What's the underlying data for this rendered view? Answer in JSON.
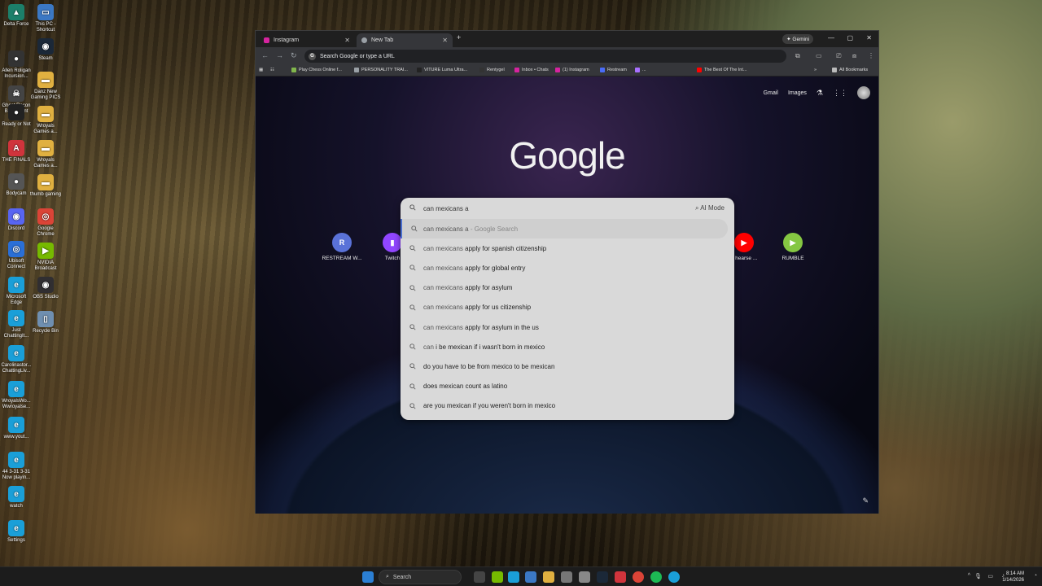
{
  "desktop_icons_left": [
    {
      "label": "Delta Force",
      "color": "#1c7f6a",
      "glyph": "▲"
    },
    {
      "label": "Allen Roligan Incursion...",
      "color": "#333333",
      "glyph": "●"
    },
    {
      "label": "Ghost Recon Breakpoint",
      "color": "#444444",
      "glyph": "☠"
    },
    {
      "label": "Ready or Not",
      "color": "#222222",
      "glyph": "●"
    },
    {
      "label": "THE FINALS",
      "color": "#d0343c",
      "glyph": "A"
    },
    {
      "label": "Bodycam",
      "color": "#555555",
      "glyph": "●"
    },
    {
      "label": "Discord",
      "color": "#5865f2",
      "glyph": "◉"
    },
    {
      "label": "Ubisoft Connect",
      "color": "#2a6fd6",
      "glyph": "◎"
    },
    {
      "label": "Microsoft Edge",
      "color": "#1a9fd8",
      "glyph": "e"
    },
    {
      "label": "Just ChattingIt...",
      "color": "#1a9fd8",
      "glyph": "e"
    },
    {
      "label": "Carolinastor... ChattingLiv...",
      "color": "#1a9fd8",
      "glyph": "e"
    },
    {
      "label": "WroyalsWo... Wwroyalse...",
      "color": "#1a9fd8",
      "glyph": "e"
    },
    {
      "label": "www.yout...",
      "color": "#1a9fd8",
      "glyph": "e"
    },
    {
      "label": "44 3-31 3-31 Now playin...",
      "color": "#1a9fd8",
      "glyph": "e"
    },
    {
      "label": "watch",
      "color": "#1a9fd8",
      "glyph": "e"
    },
    {
      "label": "Settings",
      "color": "#1a9fd8",
      "glyph": "e"
    }
  ],
  "desktop_icons_right_col": [
    {
      "label": "This PC - Shortcut",
      "color": "#3b78c4",
      "glyph": "▭"
    },
    {
      "label": "Steam",
      "color": "#1b2838",
      "glyph": "◉"
    },
    {
      "label": "Danz New Gaming PICS",
      "color": "#e0b040",
      "glyph": "▬"
    },
    {
      "label": "Wroyals Games a...",
      "color": "#e0b040",
      "glyph": "▬"
    },
    {
      "label": "Wroyals Games a...",
      "color": "#e0b040",
      "glyph": "▬"
    },
    {
      "label": "thumb gaming",
      "color": "#e0b040",
      "glyph": "▬"
    },
    {
      "label": "Google Chrome",
      "color": "#db4437",
      "glyph": "◎"
    },
    {
      "label": "NVIDIA Broadcast",
      "color": "#76b900",
      "glyph": "▶"
    },
    {
      "label": "OBS Studio",
      "color": "#302e31",
      "glyph": "◉"
    },
    {
      "label": "Recycle Bin",
      "color": "#6f8fb0",
      "glyph": "▯"
    }
  ],
  "browser": {
    "tabs": [
      {
        "label": "Instagram",
        "fav_color": "#d6249f"
      },
      {
        "label": "New Tab",
        "fav_color": "#9aa0a6"
      }
    ],
    "new_tab_symbol": "+",
    "gemini_label": "✦ Gemini",
    "omnibox_placeholder": "Search Google or type a URL",
    "bookmarks": [
      {
        "label": "Play Chess Online f...",
        "color": "#81b64c"
      },
      {
        "label": "PERSONALITY TRAI...",
        "color": "#9aa0a6"
      },
      {
        "label": "VITURE Luma Ultra...",
        "color": "#222222"
      },
      {
        "label": "Rentygel",
        "color": "#333333"
      },
      {
        "label": "Inbox • Chats",
        "color": "#d6249f"
      },
      {
        "label": "(1) Instagram",
        "color": "#d6249f"
      },
      {
        "label": "Restream",
        "color": "#4a6cf7"
      },
      {
        "label": "...",
        "color": "#a970ff"
      },
      {
        "label": "The Best Of The Int...",
        "color": "#ff0000"
      }
    ],
    "all_bookmarks": "All Bookmarks"
  },
  "ntp": {
    "gmail": "Gmail",
    "images": "Images",
    "logo": "Google",
    "shortcuts": [
      {
        "label": "RESTREAM W...",
        "glyph": "R",
        "color": "#5a72d8"
      },
      {
        "label": "Twitch",
        "glyph": "▮",
        "color": "#9146ff"
      },
      {
        "label": "n hearse ...",
        "glyph": "▶",
        "color": "#ff0000"
      },
      {
        "label": "RUMBLE",
        "glyph": "▶",
        "color": "#85c742"
      }
    ]
  },
  "search": {
    "query": "can mexicans a",
    "ai_mode": "AI Mode",
    "suggestions": [
      {
        "pre": "can mexicans a",
        "rest": "",
        "tail": " - Google Search"
      },
      {
        "pre": "can mexicans",
        "rest": " apply for spanish citizenship",
        "tail": ""
      },
      {
        "pre": "can mexicans",
        "rest": " apply for global entry",
        "tail": ""
      },
      {
        "pre": "can mexicans",
        "rest": " apply for asylum",
        "tail": ""
      },
      {
        "pre": "can mexicans",
        "rest": " apply for us citizenship",
        "tail": ""
      },
      {
        "pre": "can mexicans",
        "rest": " apply for asylum in the us",
        "tail": ""
      },
      {
        "pre": "can",
        "rest": " i be mexican if i wasn't born in mexico",
        "tail": ""
      },
      {
        "pre": "",
        "rest": "do you have to be from mexico to be mexican",
        "tail": ""
      },
      {
        "pre": "",
        "rest": "does mexican count as latino",
        "tail": ""
      },
      {
        "pre": "",
        "rest": "are you mexican if you weren't born in mexico",
        "tail": ""
      }
    ]
  },
  "taskbar": {
    "search_placeholder": "Search",
    "time": "8:14 AM",
    "date": "1/14/2026"
  }
}
